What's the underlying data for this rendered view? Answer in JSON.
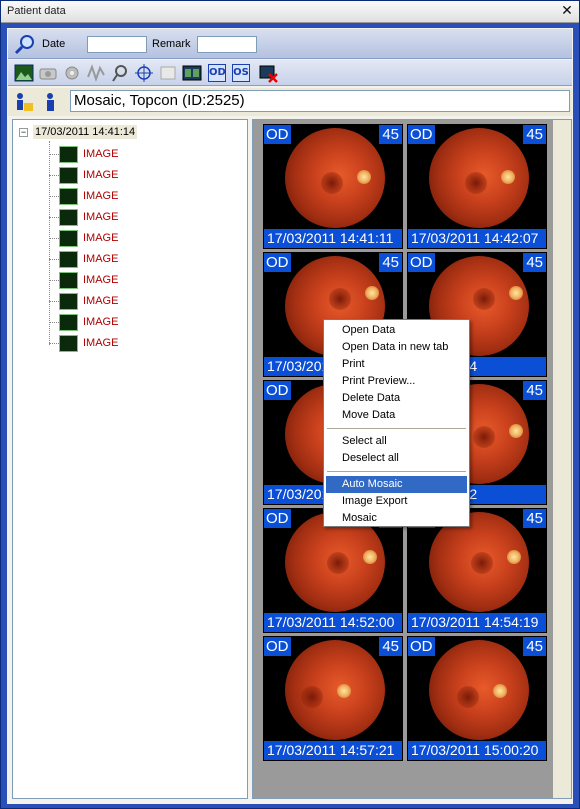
{
  "window": {
    "title": "Patient data",
    "close_glyph": "✕"
  },
  "search": {
    "date_label": "Date",
    "date_value": "",
    "remark_label": "Remark",
    "remark_value": ""
  },
  "toolbar": {
    "buttons": [
      "image-icon",
      "camera-icon",
      "settings-icon",
      "waveform-icon",
      "magnifier-icon",
      "crosshair-icon",
      "document-icon",
      "film-strip-icon"
    ],
    "od_label": "OD",
    "os_label": "OS",
    "delete_icon": "delete-icon"
  },
  "patient": {
    "name": "Mosaic, Topcon  (ID:2525)"
  },
  "tree": {
    "root_label": "17/03/2011 14:41:14",
    "expander": "−",
    "items": [
      "IMAGE",
      "IMAGE",
      "IMAGE",
      "IMAGE",
      "IMAGE",
      "IMAGE",
      "IMAGE",
      "IMAGE",
      "IMAGE",
      "IMAGE"
    ]
  },
  "images": [
    {
      "eye": "OD",
      "angle": "45",
      "timestamp": "17/03/2011 14:41:11"
    },
    {
      "eye": "OD",
      "angle": "45",
      "timestamp": "17/03/2011 14:42:07"
    },
    {
      "eye": "OD",
      "angle": "45",
      "timestamp": "17/03/2011 14:43:"
    },
    {
      "eye": "OD",
      "angle": "45",
      "timestamp": "1 14:44:24"
    },
    {
      "eye": "OD",
      "angle": "45",
      "timestamp": "17/03/2011"
    },
    {
      "eye": "OD",
      "angle": "45",
      "timestamp": "1 14:48:52"
    },
    {
      "eye": "OD",
      "angle": "45",
      "timestamp": "17/03/2011 14:52:00"
    },
    {
      "eye": "OD",
      "angle": "45",
      "timestamp": "17/03/2011 14:54:19"
    },
    {
      "eye": "OD",
      "angle": "45",
      "timestamp": "17/03/2011 14:57:21"
    },
    {
      "eye": "OD",
      "angle": "45",
      "timestamp": "17/03/2011 15:00:20"
    }
  ],
  "context_menu": {
    "group1": [
      "Open Data",
      "Open Data in new tab",
      "Print",
      "Print Preview...",
      "Delete Data",
      "Move Data"
    ],
    "group2": [
      "Select all",
      "Deselect all"
    ],
    "group3": [
      "Auto Mosaic",
      "Image Export",
      "Mosaic"
    ],
    "highlighted": "Auto Mosaic"
  }
}
